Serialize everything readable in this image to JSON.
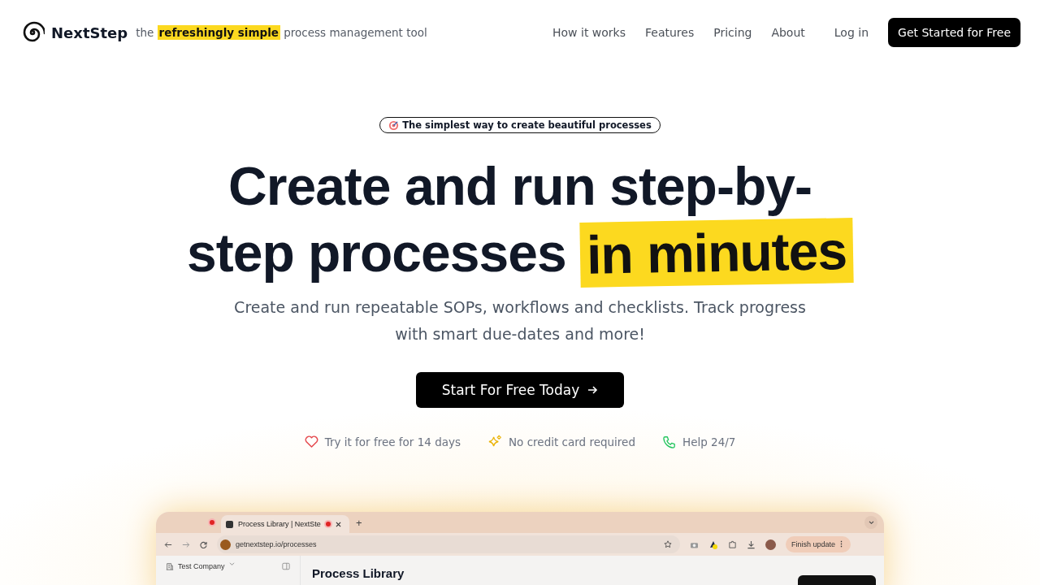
{
  "header": {
    "brand": "NextStep",
    "tagline": {
      "before": "the",
      "highlight": "refreshingly simple",
      "after": "process management tool"
    },
    "nav": [
      "How it works",
      "Features",
      "Pricing",
      "About"
    ],
    "login": "Log in",
    "cta": "Get Started for Free"
  },
  "hero": {
    "badge": "The simplest way to create beautiful processes",
    "headline": {
      "text": "Create and run step-by-step processes",
      "highlight": "in minutes"
    },
    "subtitle": "Create and run repeatable SOPs, workflows and checklists. Track progress with smart due-dates and more!",
    "cta": "Start For Free Today",
    "features": [
      {
        "kind": "heart",
        "text": "Try it for free for 14 days"
      },
      {
        "kind": "sparkle",
        "text": "No credit card required"
      },
      {
        "kind": "phone",
        "text": "Help 24/7"
      }
    ]
  },
  "preview": {
    "tab_title": "Process Library | NextSte",
    "tab_plus": "+",
    "url": "getnextstep.io/processes",
    "update_button": "Finish update",
    "update_menu": "⋮",
    "workspace": "Test Company",
    "page_title": "Process Library"
  }
}
